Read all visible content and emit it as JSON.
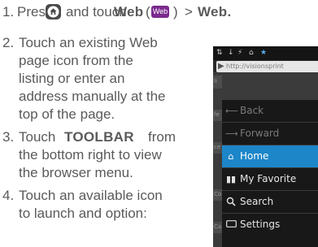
{
  "steps": [
    {
      "number": "1.",
      "parts": {
        "press": "Press",
        "and_touch": "and touch",
        "web_bold": "Web",
        "open_paren": "(",
        "close_paren": ")",
        "arrow": ">",
        "web_final": "Web."
      },
      "icons": {
        "home": "home-icon",
        "web": "Web"
      }
    },
    {
      "number": "2.",
      "lines": [
        "Touch an existing Web",
        "page  icon from the",
        "listing or enter an",
        "address manually at the",
        "top of the page."
      ]
    },
    {
      "number": "3.",
      "lines": [
        "Touch",
        "TOOLBAR",
        "from",
        "the bottom right to view",
        "the browser menu."
      ]
    },
    {
      "number": "4.",
      "lines": [
        "Touch an available icon",
        "to launch and option:"
      ]
    }
  ],
  "phone": {
    "statusbar": [
      "⇅",
      "↓",
      "⚡",
      "⌂",
      "★"
    ],
    "url": "http://visionsprint",
    "side_labels": [
      "li",
      "fe",
      "ce",
      "Co",
      "Ca"
    ],
    "menu": [
      {
        "label": "Back",
        "icon": "back-arrow-icon",
        "state": "dim"
      },
      {
        "label": "Forward",
        "icon": "forward-arrow-icon",
        "state": "dim"
      },
      {
        "label": "Home",
        "icon": "home-icon",
        "state": "active"
      },
      {
        "label": "My Favorite",
        "icon": "bookmarks-icon",
        "state": "normal"
      },
      {
        "label": "Search",
        "icon": "search-icon",
        "state": "normal"
      },
      {
        "label": "Settings",
        "icon": "settings-icon",
        "state": "normal"
      }
    ],
    "colors": {
      "highlight": "#1d86c9",
      "menu_bg": "#181818",
      "web_badge": "#7b2a8e"
    }
  }
}
